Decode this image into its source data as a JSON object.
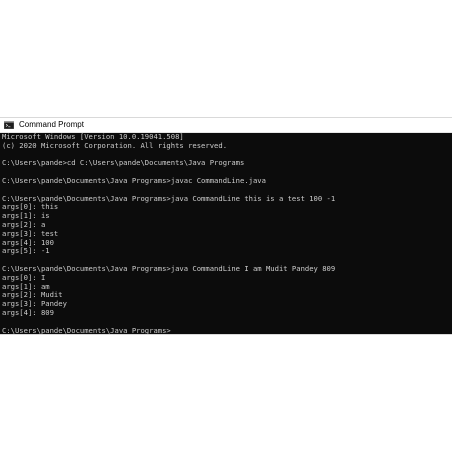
{
  "window": {
    "title": "Command Prompt",
    "icon": "cmd-icon"
  },
  "console": {
    "lines": [
      "Microsoft Windows [Version 10.0.19041.508]",
      "(c) 2020 Microsoft Corporation. All rights reserved.",
      "",
      "C:\\Users\\pande>cd C:\\Users\\pande\\Documents\\Java Programs",
      "",
      "C:\\Users\\pande\\Documents\\Java Programs>javac CommandLine.java",
      "",
      "C:\\Users\\pande\\Documents\\Java Programs>java CommandLine this is a test 100 -1",
      "args[0]: this",
      "args[1]: is",
      "args[2]: a",
      "args[3]: test",
      "args[4]: 100",
      "args[5]: -1",
      "",
      "C:\\Users\\pande\\Documents\\Java Programs>java CommandLine I am Mudit Pandey 809",
      "args[0]: I",
      "args[1]: am",
      "args[2]: Mudit",
      "args[3]: Pandey",
      "args[4]: 809",
      "",
      "C:\\Users\\pande\\Documents\\Java Programs>"
    ]
  },
  "colors": {
    "console_background": "#0c0c0c",
    "console_text": "#cccccc",
    "titlebar_background": "#ffffff"
  }
}
